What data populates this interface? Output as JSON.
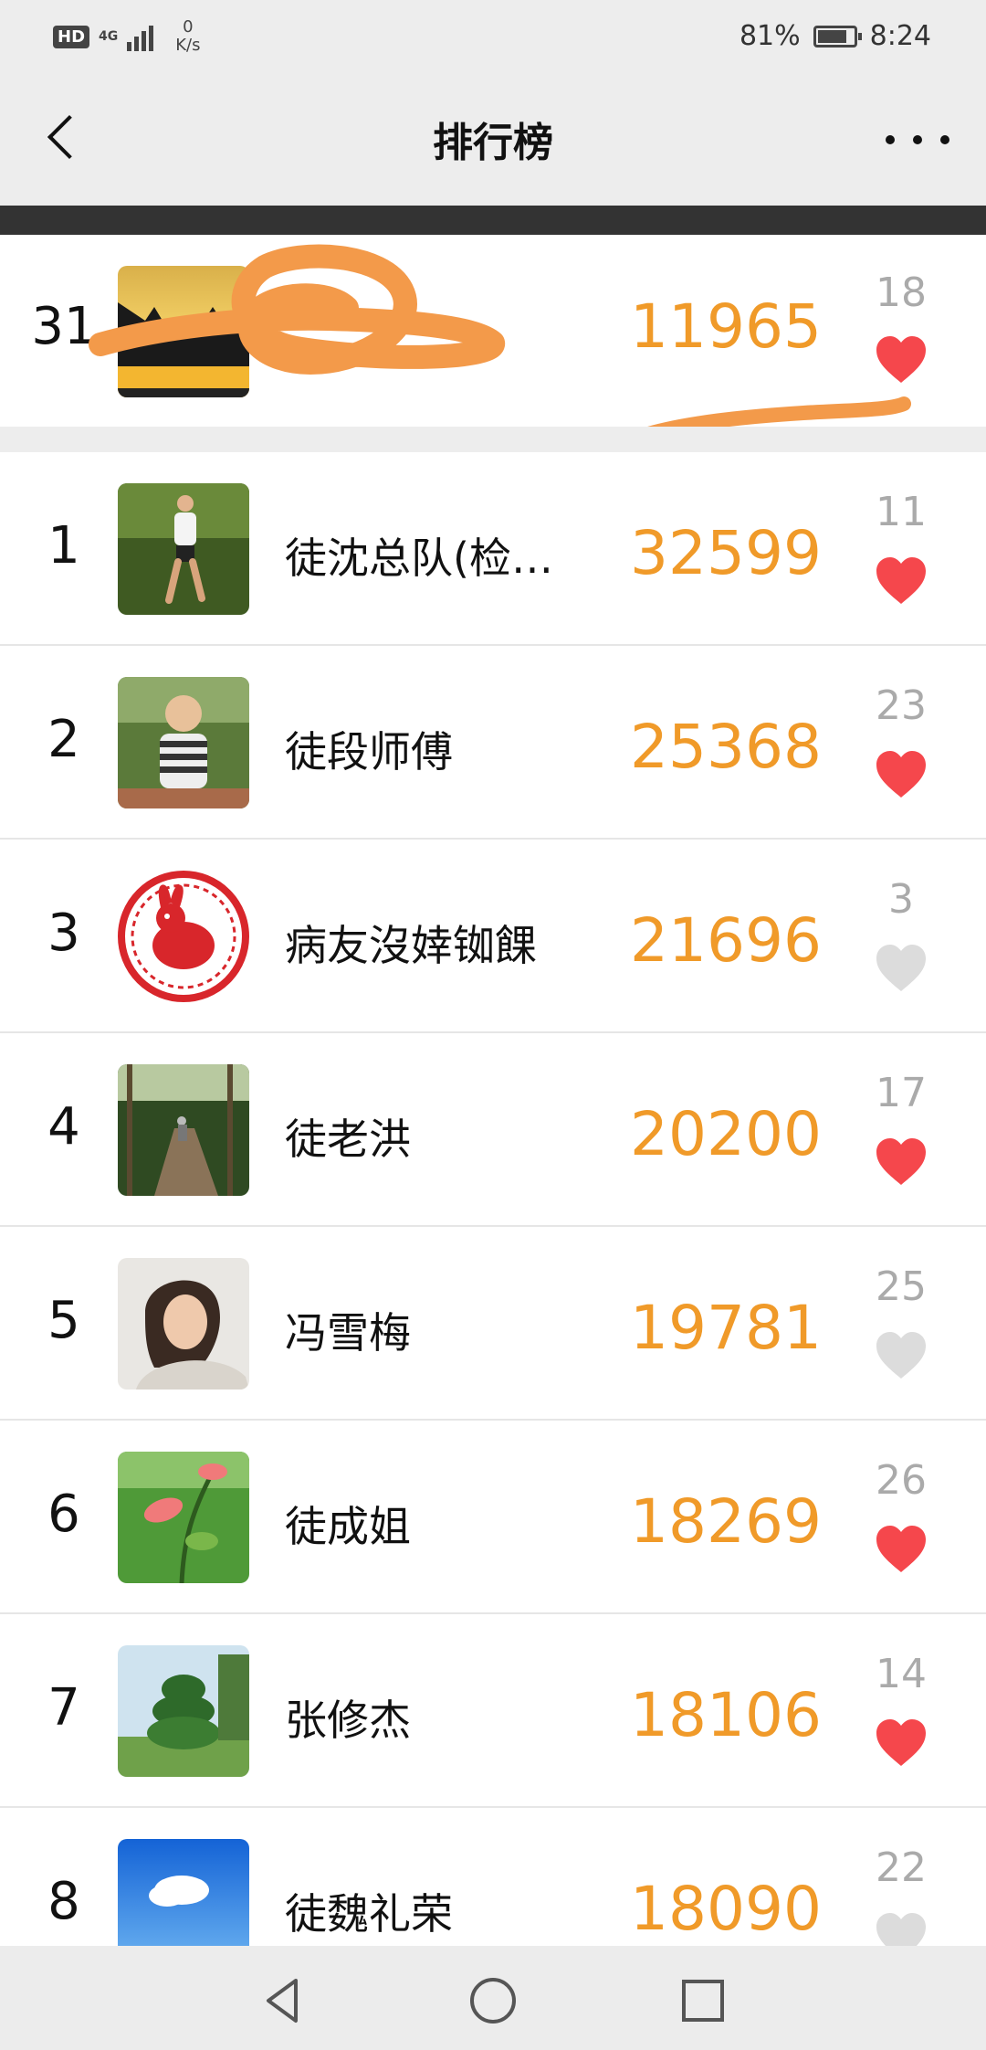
{
  "status_bar": {
    "hd": "HD",
    "network": "4G",
    "speed_value": "0",
    "speed_unit": "K/s",
    "battery_percent": "81%",
    "battery_level": 0.81,
    "time": "8:24"
  },
  "navbar": {
    "title": "排行榜",
    "back_icon": "chevron-left-icon",
    "more_icon": "more-horizontal-icon"
  },
  "my_entry": {
    "rank": "31",
    "steps": "11965",
    "likes": "18",
    "liked": true
  },
  "colors": {
    "steps": "#f09a29",
    "heart_liked": "#f5474c",
    "heart_unliked": "#dcdcdc",
    "scribble": "#f39a4a"
  },
  "ranking": [
    {
      "rank": "1",
      "name": "徒沈总队(检…",
      "steps": "32599",
      "likes": "11",
      "liked": true,
      "avatar": "runner"
    },
    {
      "rank": "2",
      "name": "徒段师傅",
      "steps": "25368",
      "likes": "23",
      "liked": true,
      "avatar": "child"
    },
    {
      "rank": "3",
      "name": "病友沒婞铷餜",
      "steps": "21696",
      "likes": "3",
      "liked": false,
      "avatar": "papercut"
    },
    {
      "rank": "4",
      "name": "徒老洪",
      "steps": "20200",
      "likes": "17",
      "liked": true,
      "avatar": "forest-path"
    },
    {
      "rank": "5",
      "name": "冯雪梅",
      "steps": "19781",
      "likes": "25",
      "liked": false,
      "avatar": "woman"
    },
    {
      "rank": "6",
      "name": "徒成姐",
      "steps": "18269",
      "likes": "26",
      "liked": true,
      "avatar": "flower"
    },
    {
      "rank": "7",
      "name": "张修杰",
      "steps": "18106",
      "likes": "14",
      "liked": true,
      "avatar": "topiary"
    },
    {
      "rank": "8",
      "name": "徒魏礼荣",
      "steps": "18090",
      "likes": "22",
      "liked": false,
      "avatar": "sky"
    }
  ],
  "system_nav": {
    "back": "nav-back-icon",
    "home": "nav-home-icon",
    "recents": "nav-recents-icon"
  }
}
